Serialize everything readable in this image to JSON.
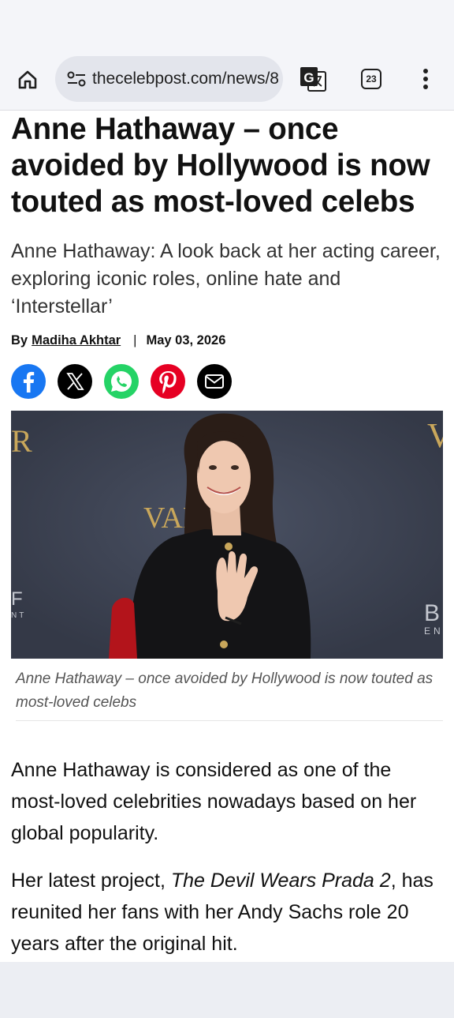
{
  "browser": {
    "url": "thecelebpost.com/news/8",
    "tab_count": "23"
  },
  "article": {
    "headline": "Anne Hathaway – once avoided by Hollywood is now touted as most-loved celebs",
    "subheadline": "Anne Hathaway: A look back at her acting career, exploring iconic roles, online hate and ‘Interstellar’",
    "byline_prefix": "By",
    "author": "Madiha Akhtar",
    "separator": "|",
    "date": "May 03, 2026",
    "share": [
      "facebook",
      "x",
      "whatsapp",
      "pinterest",
      "email"
    ],
    "image_caption": "Anne Hathaway – once avoided by Hollywood is now touted as most-loved celebs",
    "backdrop_letters": [
      "R",
      "V",
      "VAN",
      "F",
      "NT",
      "B",
      "EN"
    ],
    "paragraph1": "Anne Hathaway is considered as one of the most-loved celebrities nowadays based on her global popularity.",
    "paragraph2_before": "Her latest project, ",
    "paragraph2_title": "The Devil Wears Prada 2",
    "paragraph2_after": ", has reunited her fans with her Andy Sachs role 20 years after the original hit."
  },
  "colors": {
    "facebook": "#1877f2",
    "x": "#000000",
    "whatsapp": "#25d366",
    "pinterest": "#e60023",
    "email": "#000000"
  }
}
